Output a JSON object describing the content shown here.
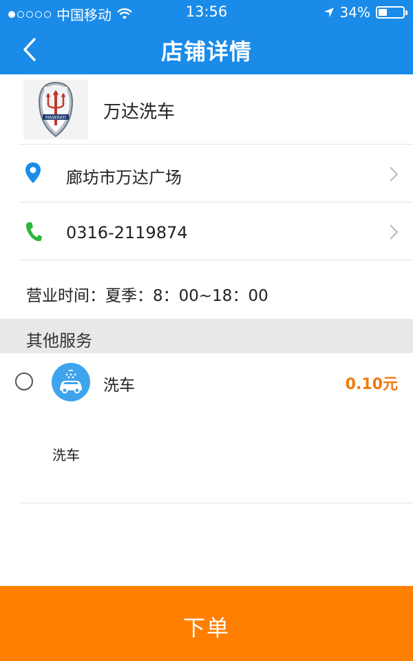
{
  "status_bar": {
    "carrier": "中国移动",
    "time": "13:56",
    "battery": "34%",
    "battery_level": 0.34
  },
  "nav": {
    "title": "店铺详情"
  },
  "shop": {
    "name": "万达洗车",
    "logo_text": "MASERATI",
    "address": "廊坊市万达广场",
    "phone": "0316-2119874",
    "hours": "营业时间：夏季：8：00~18：00"
  },
  "section": {
    "title": "其他服务"
  },
  "services": [
    {
      "name": "洗车",
      "price": "0.10元",
      "description": "洗车"
    }
  ],
  "actions": {
    "order_label": "下单"
  },
  "colors": {
    "primary": "#1a8be8",
    "accent": "#ff7f00",
    "price": "#f07a0f",
    "location_icon": "#1a8be8",
    "phone_icon": "#2bb63a"
  }
}
